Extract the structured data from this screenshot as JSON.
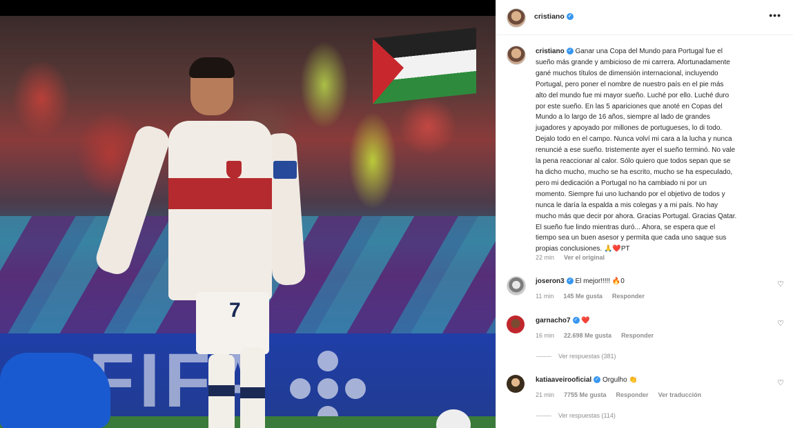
{
  "post": {
    "username": "cristiano",
    "caption_lines": [
      "Ganar una Copa del Mundo para Portugal fue el",
      "sueño más grande y ambicioso de mi carrera. Afortunadamente",
      "gané muchos títulos de dimensión internacional, incluyendo",
      "Portugal, pero poner el nombre de nuestro país en el pie más",
      "alto del mundo fue mi mayor sueño. Luché por ello. Luché duro",
      "por este sueño. En las 5 apariciones que anoté en Copas del",
      "Mundo a lo largo de 16 años, siempre al lado de grandes",
      "jugadores y apoyado por millones de portugueses, lo di todo.",
      "Dejalo todo en el campo. Nunca volví mi cara a la lucha y nunca",
      "renuncié a ese sueño. tristemente ayer el sueño terminó. No vale",
      "la pena reaccionar al calor. Sólo quiero que todos sepan que se",
      "ha dicho mucho, mucho se ha escrito, mucho se ha especulado,",
      "pero mi dedicación a Portugal no ha cambiado ni por un",
      "momento. Siempre fui uno luchando por el objetivo de todos y",
      "nunca le daría la espalda a mis colegas y a mi país. No hay",
      "mucho más que decir por ahora. Gracias Portugal. Gracias Qatar.",
      "El sueño fue lindo mientras duró... Ahora, se espera que el",
      "tiempo sea un buen asesor y permita que cada uno saque sus",
      "propias conclusiones. 🙏❤️PT"
    ],
    "time": "22 min",
    "see_original": "Ver el original"
  },
  "header": {
    "username": "cristiano",
    "more": "•••"
  },
  "comments": [
    {
      "username": "joseron3",
      "text": "El mejor!!!!! 🔥0",
      "time": "11 min",
      "likes": "145 Me gusta",
      "reply": "Responder"
    },
    {
      "username": "garnacho7",
      "text": "❤️",
      "time": "16 min",
      "likes": "22.698 Me gusta",
      "reply": "Responder",
      "view_replies": "Ver respuestas (381)"
    },
    {
      "username": "katiaaveirooficial",
      "text": "Orgulho 👏",
      "time": "21 min",
      "likes": "7755 Me gusta",
      "reply": "Responder",
      "translate": "Ver traducción",
      "view_replies": "Ver respuestas (114)"
    }
  ],
  "image": {
    "board_text": "FIFA",
    "shorts_number": "7"
  },
  "icons": {
    "verified": "verified-badge-icon",
    "heart": "heart-icon",
    "more": "more-options-icon"
  },
  "colors": {
    "verified": "#3897f0",
    "heart_red": "#ed4956",
    "muted": "#8e8e8e"
  }
}
